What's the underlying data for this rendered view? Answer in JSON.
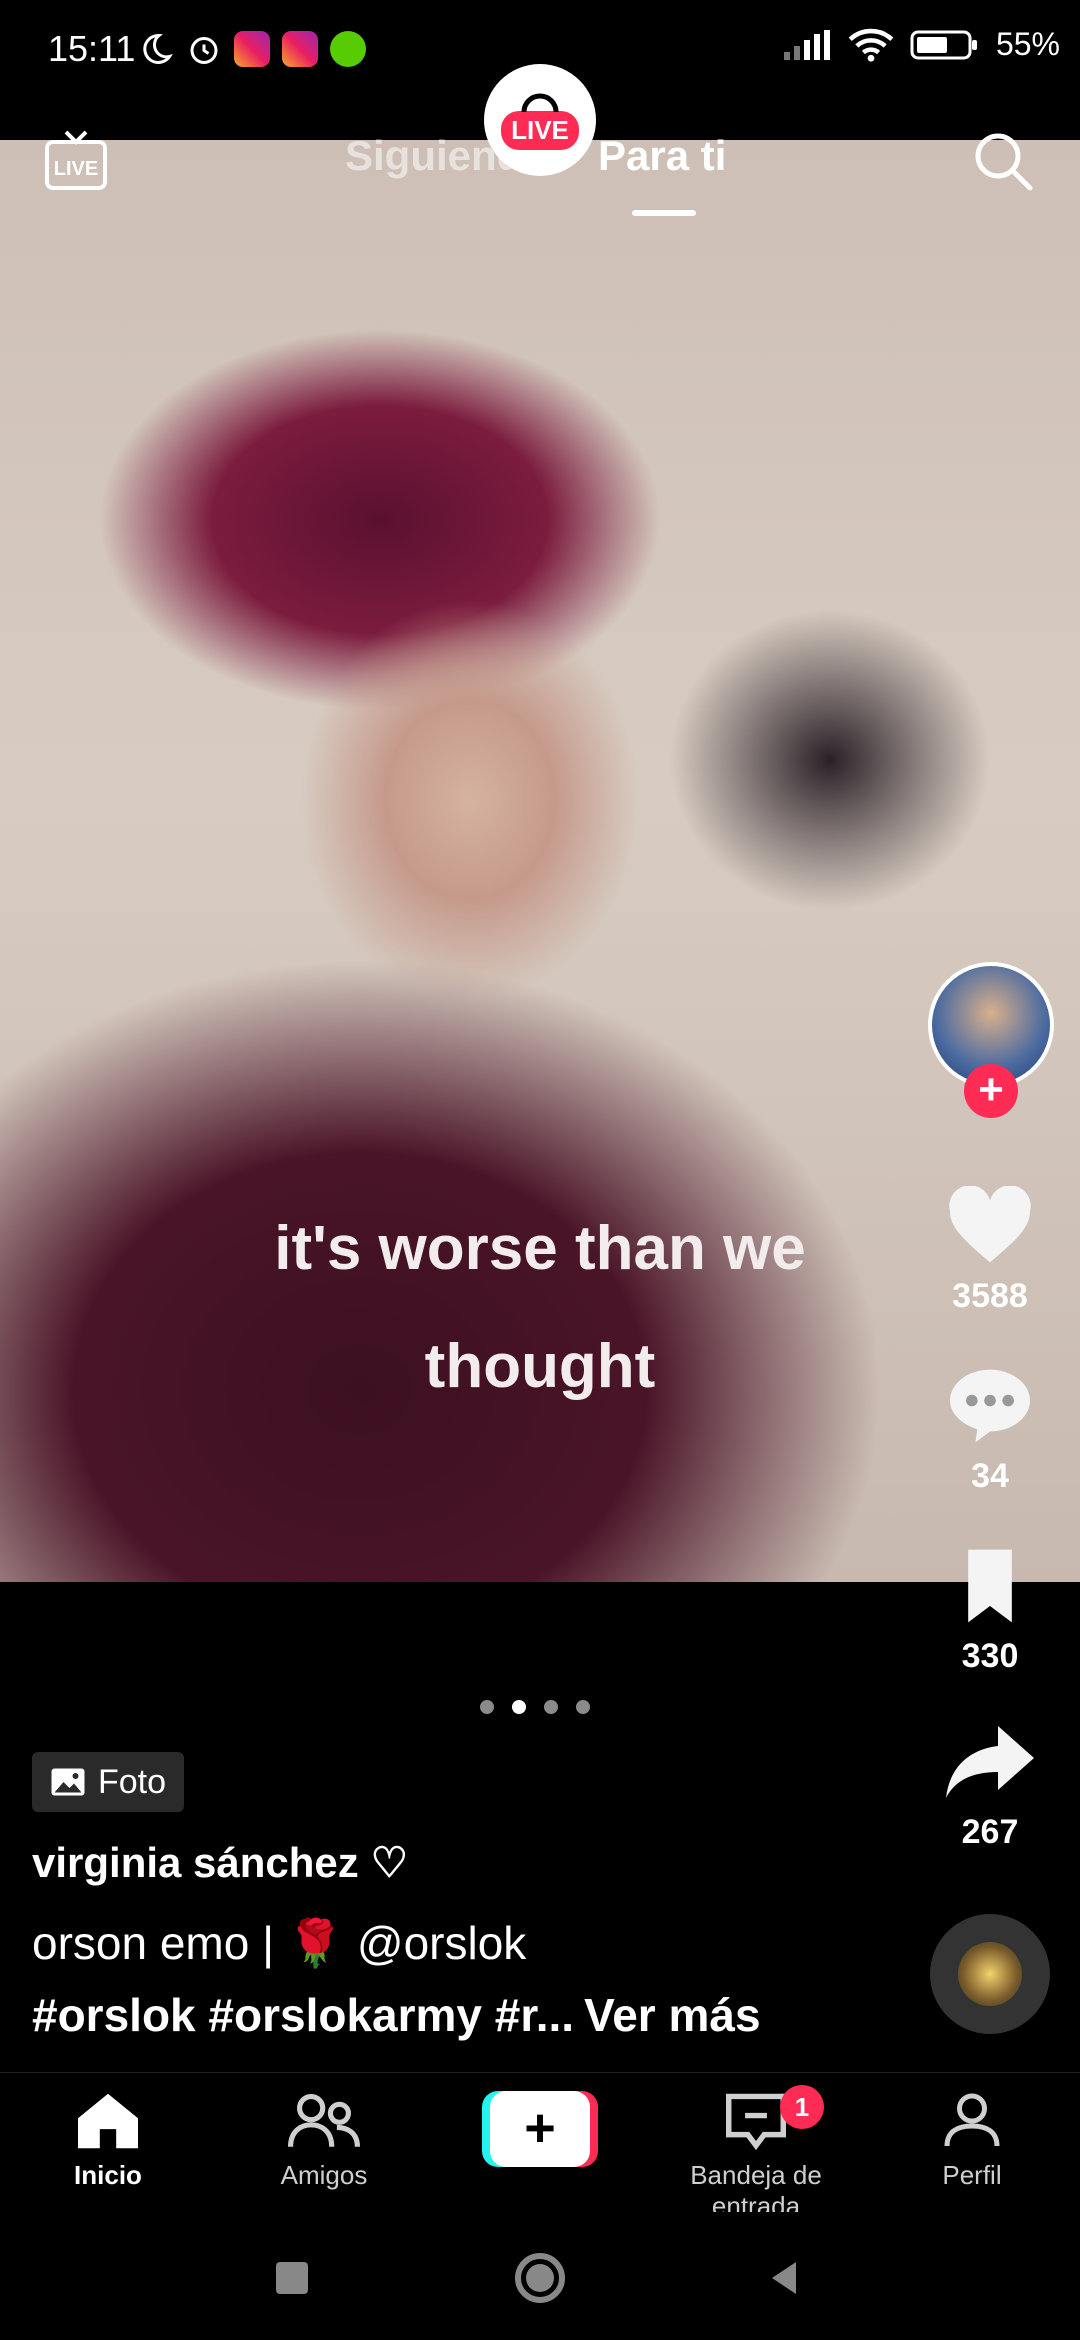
{
  "status_bar": {
    "time": "15:11",
    "battery": "55%"
  },
  "top_bar": {
    "tabs": [
      {
        "label": "Siguiendo",
        "active": false
      },
      {
        "label": "Para ti",
        "active": true
      }
    ],
    "live_badge": "LIVE",
    "live_icon_text": "LIVE"
  },
  "post": {
    "caption_overlay_line1": "it's worse than we",
    "caption_overlay_line2": "thought",
    "carousel_dots": 4,
    "active_dot": 2,
    "type_chip": "Foto",
    "username": "virginia sánchez ♡",
    "description": "orson emo | 🌹 @orslok",
    "hashtags": "#orslok #orslokarmy #r...",
    "see_more": "Ver más"
  },
  "actions": {
    "likes": "3588",
    "comments": "34",
    "saves": "330",
    "shares": "267"
  },
  "bottom_nav": {
    "items": [
      {
        "label": "Inicio",
        "active": true
      },
      {
        "label": "Amigos",
        "active": false
      },
      {
        "label": "Bandeja de entrada",
        "active": false,
        "badge": "1"
      },
      {
        "label": "Perfil",
        "active": false
      }
    ]
  },
  "colors": {
    "accent": "#fe2c55",
    "cyan": "#25f4ee"
  }
}
